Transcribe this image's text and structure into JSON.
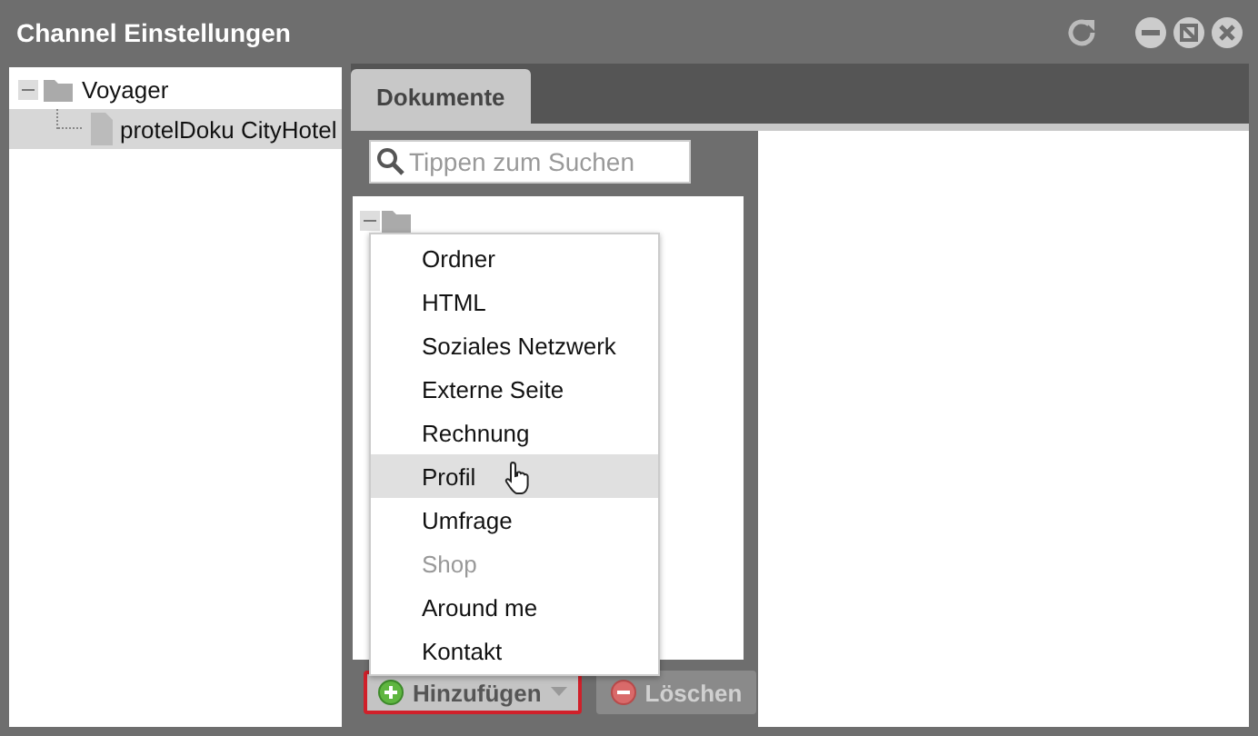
{
  "window": {
    "title": "Channel Einstellungen"
  },
  "tree": [
    {
      "label": "Voyager",
      "expanded": true,
      "selected": false,
      "children": [
        {
          "label": "protelDoku CityHotel",
          "selected": true
        }
      ]
    }
  ],
  "tabs": [
    {
      "label": "Dokumente",
      "selected": true
    }
  ],
  "search": {
    "placeholder": "Tippen zum Suchen"
  },
  "document_tree": [
    {
      "expanded": true
    }
  ],
  "add_menu": {
    "items": [
      {
        "label": "Ordner",
        "selected": false,
        "disabled": false
      },
      {
        "label": "HTML",
        "selected": false,
        "disabled": false
      },
      {
        "label": "Soziales Netzwerk",
        "selected": false,
        "disabled": false
      },
      {
        "label": "Externe Seite",
        "selected": false,
        "disabled": false
      },
      {
        "label": "Rechnung",
        "selected": false,
        "disabled": false
      },
      {
        "label": "Profil",
        "selected": true,
        "disabled": false
      },
      {
        "label": "Umfrage",
        "selected": false,
        "disabled": false
      },
      {
        "label": "Shop",
        "selected": false,
        "disabled": true
      },
      {
        "label": "Around me",
        "selected": false,
        "disabled": false
      },
      {
        "label": "Kontakt",
        "selected": false,
        "disabled": false
      }
    ]
  },
  "buttons": [
    {
      "label": "Hinzufügen",
      "kind": "add",
      "focused": true,
      "disabled": false
    },
    {
      "label": "Löschen",
      "kind": "delete",
      "focused": false,
      "disabled": true
    }
  ]
}
